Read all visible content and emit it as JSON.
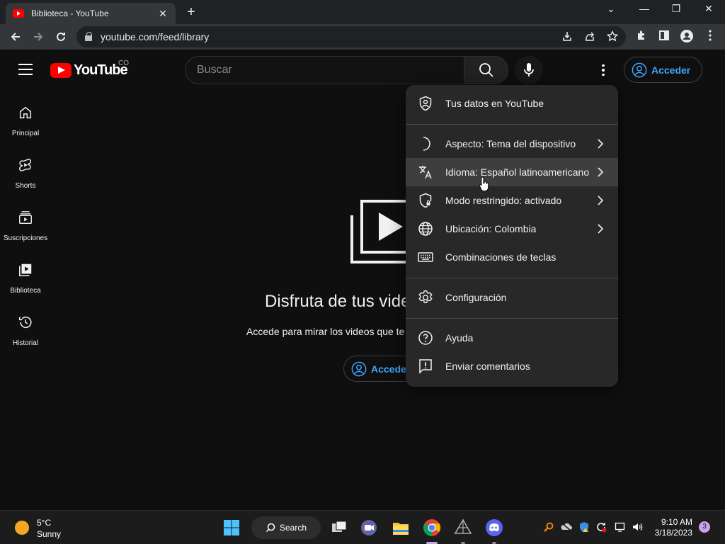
{
  "browser": {
    "tab_title": "Biblioteca - YouTube",
    "tab_close": "✕",
    "new_tab": "+",
    "url": "youtube.com/feed/library",
    "window_minimize": "—",
    "window_restore": "❐",
    "window_close": "✕",
    "tab_list": "⌄"
  },
  "header": {
    "logo_text": "YouTube",
    "country_code": "CO",
    "search_placeholder": "Buscar",
    "signin_label": "Acceder"
  },
  "sidebar": {
    "items": [
      {
        "label": "Principal",
        "icon": "home-icon"
      },
      {
        "label": "Shorts",
        "icon": "shorts-icon"
      },
      {
        "label": "Suscripciones",
        "icon": "subscriptions-icon"
      },
      {
        "label": "Biblioteca",
        "icon": "library-icon"
      },
      {
        "label": "Historial",
        "icon": "history-icon"
      }
    ]
  },
  "main": {
    "heading": "Disfruta de tus vide",
    "subtext": "Accede para mirar los videos que te",
    "signin_label": "Accede"
  },
  "menu": {
    "items": [
      {
        "label": "Tus datos en YouTube"
      },
      {
        "label": "Aspecto: Tema del dispositivo"
      },
      {
        "label": "Idioma: Español latinoamericano"
      },
      {
        "label": "Modo restringido: activado"
      },
      {
        "label": "Ubicación: Colombia"
      },
      {
        "label": "Combinaciones de teclas"
      },
      {
        "label": "Configuración"
      },
      {
        "label": "Ayuda"
      },
      {
        "label": "Enviar comentarios"
      }
    ]
  },
  "taskbar": {
    "weather_temp": "5°C",
    "weather_desc": "Sunny",
    "search_label": "Search",
    "time": "9:10 AM",
    "date": "3/18/2023",
    "notification_count": "3"
  },
  "colors": {
    "accent_blue": "#3ea6ff",
    "youtube_red": "#ff0000",
    "menu_bg": "#282828",
    "page_bg": "#0f0f0f"
  }
}
